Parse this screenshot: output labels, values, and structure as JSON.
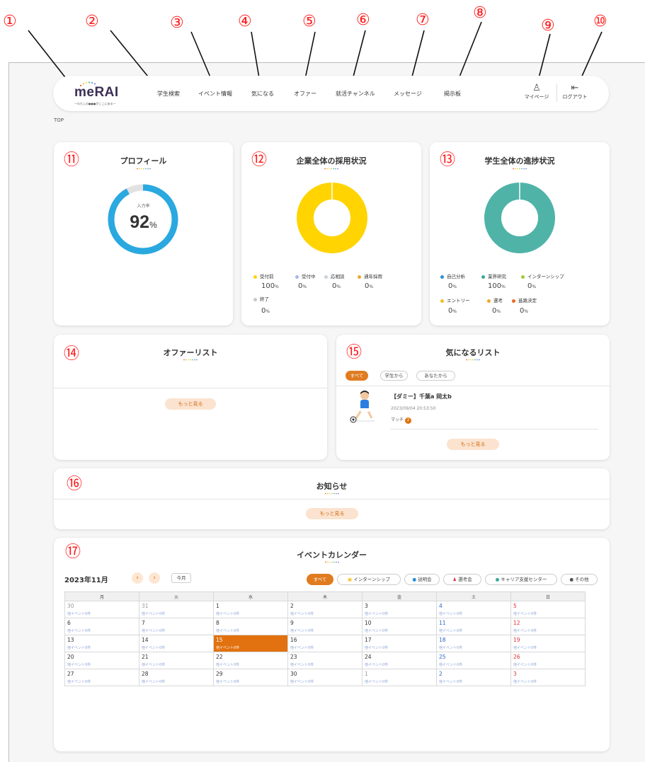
{
  "annotations": [
    "①",
    "②",
    "③",
    "④",
    "⑤",
    "⑥",
    "⑦",
    "⑧",
    "⑨",
    "⑩",
    "⑪",
    "⑫",
    "⑬",
    "⑭",
    "⑮",
    "⑯",
    "⑰"
  ],
  "logo": {
    "name": "meRAI",
    "tagline": "—わたしの●●●がここにある—"
  },
  "nav": {
    "items": [
      "学生検索",
      "イベント情報",
      "気になる",
      "オファー",
      "就活チャンネル",
      "メッセージ",
      "掲示板"
    ],
    "mypage": "マイページ",
    "logout": "ログアウト"
  },
  "breadcrumb": "TOP",
  "profile": {
    "title": "プロフィール",
    "rate_label": "入力率",
    "rate_value": "92",
    "rate_unit": "%",
    "rate_fraction": 0.92,
    "accent": "#2aa9e0"
  },
  "company": {
    "title": "企業全体の採用状況",
    "donut_color": "#ffd400",
    "legend": [
      {
        "label": "受付前",
        "value": "100",
        "unit": "%",
        "color": "#ffd400"
      },
      {
        "label": "受付中",
        "value": "0",
        "unit": "%",
        "color": "#a8b8e8"
      },
      {
        "label": "応相談",
        "value": "0",
        "unit": "%",
        "color": "#c8d2dc"
      },
      {
        "label": "通年採用",
        "value": "0",
        "unit": "%",
        "color": "#f2a72e"
      },
      {
        "label": "終了",
        "value": "0",
        "unit": "%",
        "color": "#c8c8c8"
      }
    ]
  },
  "students": {
    "title": "学生全体の進捗状況",
    "donut_color": "#4fb3a8",
    "legend": [
      {
        "label": "自己分析",
        "value": "0",
        "unit": "%",
        "color": "#2b8fd6"
      },
      {
        "label": "業界研究",
        "value": "100",
        "unit": "%",
        "color": "#3aa99a"
      },
      {
        "label": "インターンシップ",
        "value": "0",
        "unit": "%",
        "color": "#9ccc3a"
      },
      {
        "label": "エントリー",
        "value": "0",
        "unit": "%",
        "color": "#f2c01e"
      },
      {
        "label": "選考",
        "value": "0",
        "unit": "%",
        "color": "#f2a72e"
      },
      {
        "label": "進路決定",
        "value": "0",
        "unit": "%",
        "color": "#ea6a1e"
      }
    ]
  },
  "offers": {
    "title": "オファーリスト",
    "more": "もっと見る"
  },
  "watchlist": {
    "title": "気になるリスト",
    "tabs": [
      "すべて",
      "学生から",
      "あなたから"
    ],
    "item": {
      "name": "【ダミー】千葉a 岡太b",
      "datetime": "2023/09/04 20:53:50",
      "match_label": "マッチ",
      "match_count": "2"
    },
    "more": "もっと見る"
  },
  "news": {
    "title": "お知らせ",
    "more": "もっと見る"
  },
  "calendar": {
    "title": "イベントカレンダー",
    "month": "2023年11月",
    "prev": "‹",
    "next": "›",
    "today_btn": "今月",
    "filters": [
      "すべて",
      "インターンシップ",
      "説明会",
      "選考会",
      "キャリア支援センター",
      "その他"
    ],
    "weekdays": [
      "月",
      "火",
      "水",
      "木",
      "金",
      "土",
      "日"
    ],
    "event_text": "他イベント0件",
    "weeks": [
      [
        "30",
        "31",
        "1",
        "2",
        "3",
        "4",
        "5"
      ],
      [
        "6",
        "7",
        "8",
        "9",
        "10",
        "11",
        "12"
      ],
      [
        "13",
        "14",
        "15",
        "16",
        "17",
        "18",
        "19"
      ],
      [
        "20",
        "21",
        "22",
        "23",
        "24",
        "25",
        "26"
      ],
      [
        "27",
        "28",
        "29",
        "30",
        "1",
        "2",
        "3"
      ]
    ],
    "today": "15"
  }
}
